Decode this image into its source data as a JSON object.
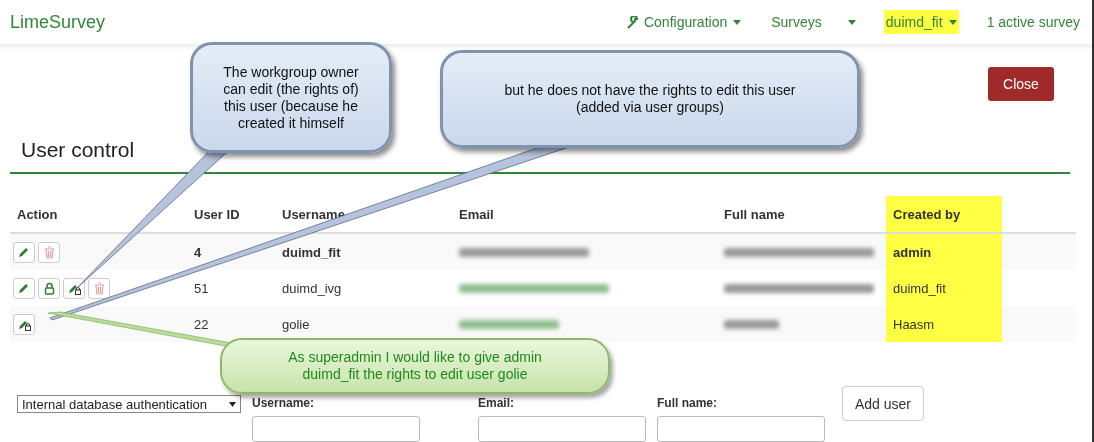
{
  "navbar": {
    "brand": "LimeSurvey",
    "items": [
      {
        "kind": "tool",
        "label": "Configuration",
        "dropdown": true,
        "highlighted": false
      },
      {
        "kind": "plain",
        "label": "Surveys",
        "dropdown": true,
        "highlighted": false
      },
      {
        "kind": "plain",
        "label": "duimd_fit",
        "dropdown": true,
        "highlighted": true
      },
      {
        "kind": "plain",
        "label": "1 active survey",
        "dropdown": false,
        "highlighted": false
      }
    ]
  },
  "close_button": "Close",
  "heading": "User control",
  "table": {
    "columns": [
      {
        "label": "Action",
        "highlighted": false
      },
      {
        "label": "User ID",
        "highlighted": false
      },
      {
        "label": "Username",
        "highlighted": false
      },
      {
        "label": "Email",
        "highlighted": false
      },
      {
        "label": "Full name",
        "highlighted": false
      },
      {
        "label": "Created by",
        "highlighted": true
      }
    ],
    "rows": [
      {
        "current": true,
        "actions": [
          {
            "kind": "edit"
          },
          {
            "kind": "delete"
          }
        ],
        "user_id": "4",
        "username": "duimd_fit",
        "created_by": "admin"
      },
      {
        "current": false,
        "actions": [
          {
            "kind": "edit"
          },
          {
            "kind": "lock"
          },
          {
            "kind": "rights"
          },
          {
            "kind": "delete"
          }
        ],
        "user_id": "51",
        "username": "duimd_ivg",
        "created_by": "duimd_fit"
      },
      {
        "current": false,
        "actions": [
          {
            "kind": "rights"
          }
        ],
        "user_id": "22",
        "username": "golie",
        "created_by": "Haasm"
      }
    ]
  },
  "add_form": {
    "auth_select": "Internal database authentication",
    "fields": [
      {
        "label": "Username:"
      },
      {
        "label": "Email:"
      },
      {
        "label": "Full name:"
      }
    ],
    "button": "Add user"
  },
  "callouts": [
    {
      "kind": "blue",
      "text": "The workgroup owner can edit (the rights of) this user (because he created it himself"
    },
    {
      "kind": "blue",
      "text": "but he does not have the rights to edit this user (added via user groups)"
    },
    {
      "kind": "green",
      "text": "As superadmin I would like to give  admin duimd_fit the rights to edit user golie"
    }
  ]
}
